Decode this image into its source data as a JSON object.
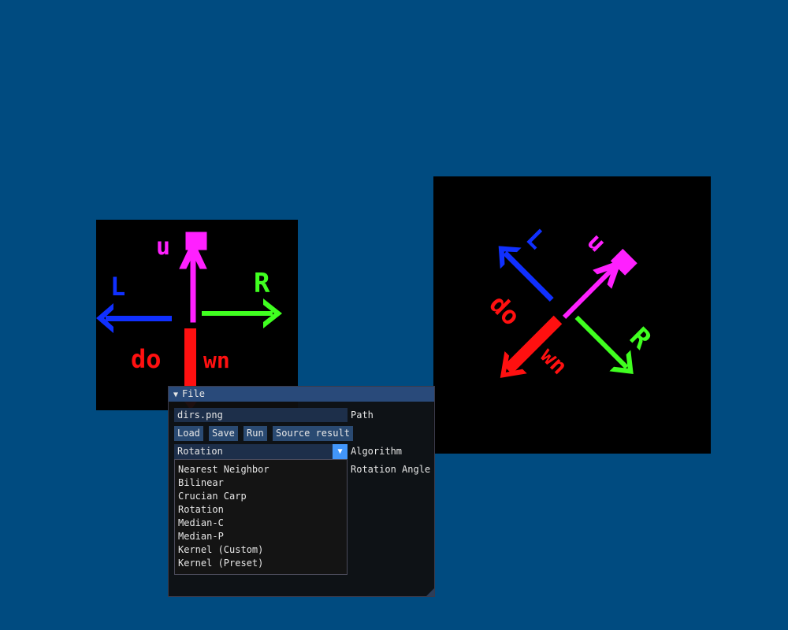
{
  "window": {
    "title": "File",
    "collapse_glyph": "▼"
  },
  "path": {
    "value": "dirs.png",
    "label": "Path"
  },
  "buttons": {
    "load": "Load",
    "save": "Save",
    "run": "Run",
    "source_result": "Source result"
  },
  "algorithm": {
    "selected": "Rotation",
    "label": "Algorithm",
    "arrow_glyph": "▼",
    "options": [
      "Nearest Neighbor",
      "Bilinear",
      "Crucian Carp",
      "Rotation",
      "Median-C",
      "Median-P",
      "Kernel (Custom)",
      "Kernel (Preset)"
    ]
  },
  "rotation_angle": {
    "label": "Rotation Angle"
  },
  "colors": {
    "background": "#004b80",
    "up": "#ff20ff",
    "right": "#40ff20",
    "left": "#1030ff",
    "down": "#ff1010",
    "accent": "#4296fa"
  },
  "source_image": {
    "glyphs": {
      "up": "u",
      "right": "R",
      "left": "L",
      "down": "do",
      "down_extra": "wn"
    }
  },
  "result_image": {
    "rotation_deg": 45
  }
}
